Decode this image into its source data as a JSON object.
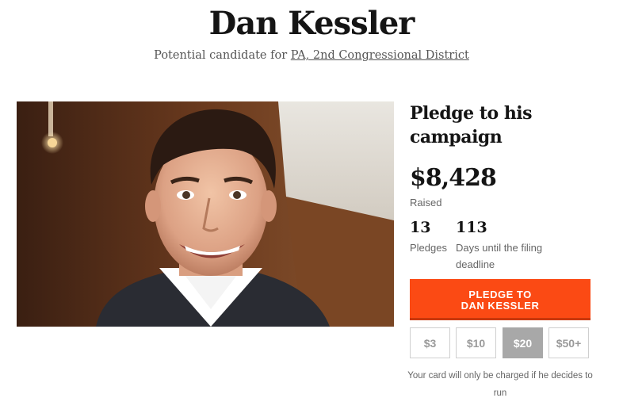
{
  "candidate": {
    "name": "Dan Kessler",
    "subtitle_prefix": "Potential candidate for",
    "district_link": "PA, 2nd Congressional District"
  },
  "photo": {
    "subject": "portrait of the candidate smiling"
  },
  "pledge": {
    "heading": "Pledge to his campaign",
    "raised_amount": "$8,428",
    "raised_label": "Raised",
    "pledges_count": "13",
    "pledges_label": "Pledges",
    "days_count": "113",
    "days_label": "Days until the filing deadline",
    "button_line1": "Pledge to",
    "button_line2": "Dan Kessler",
    "amounts": [
      "$3",
      "$10",
      "$20",
      "$50+"
    ],
    "selected_amount": "$20",
    "disclaimer": "Your card will only be charged if he decides to run"
  },
  "colors": {
    "accent": "#fb4a14",
    "selected_amount_bg": "#a8a8a8"
  }
}
